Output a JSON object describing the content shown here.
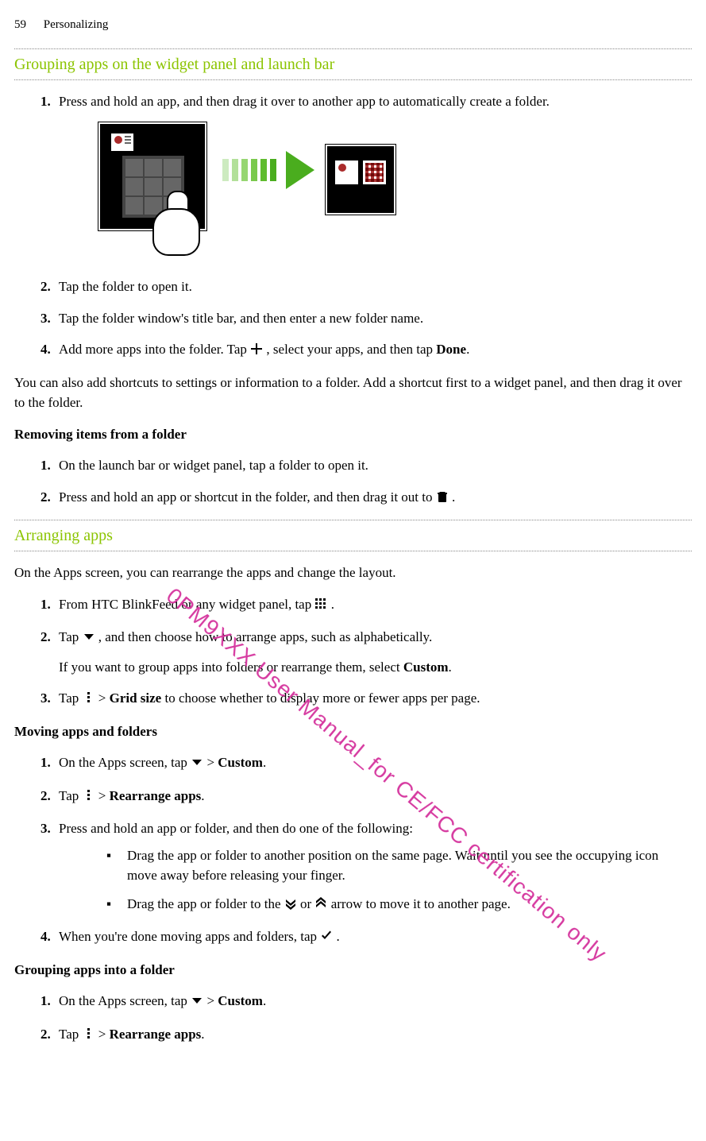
{
  "header": {
    "page_no": "59",
    "section": "Personalizing"
  },
  "watermark": "0PM9XXX User Manual_for CE/FCC certification only",
  "s1": {
    "title": "Grouping apps on the widget panel and launch bar",
    "step1": "Press and hold an app, and then drag it over to another app to automatically create a folder.",
    "step2": "Tap the folder to open it.",
    "step3": "Tap the folder window's title bar, and then enter a new folder name.",
    "step4_a": "Add more apps into the folder. Tap ",
    "step4_b": ", select your apps, and then tap ",
    "step4_done": "Done",
    "step4_c": ".",
    "after": "You can also add shortcuts to settings or information to a folder. Add a shortcut first to a widget panel, and then drag it over to the folder.",
    "sub": "Removing items from a folder",
    "r1": "On the launch bar or widget panel, tap a folder to open it.",
    "r2_a": "Press and hold an app or shortcut in the folder, and then drag it out to ",
    "r2_b": " ."
  },
  "s2": {
    "title": "Arranging apps",
    "intro": "On the Apps screen, you can rearrange the apps and change the layout.",
    "a1_a": "From HTC BlinkFeed or any widget panel, tap ",
    "a1_b": " .",
    "a2_a": "Tap ",
    "a2_b": " , and then choose how to arrange apps, such as alphabetically.",
    "a2_note_a": "If you want to group apps into folders or rearrange them, select ",
    "a2_note_custom": "Custom",
    "a2_note_b": ".",
    "a3_a": "Tap ",
    "a3_b": " > ",
    "a3_grid": "Grid size",
    "a3_c": " to choose whether to display more or fewer apps per page.",
    "moving_sub": "Moving apps and folders",
    "m1_a": "On the Apps screen, tap ",
    "m1_b": " > ",
    "m1_custom": "Custom",
    "m1_c": ".",
    "m2_a": "Tap ",
    "m2_b": " > ",
    "m2_rearr": "Rearrange apps",
    "m2_c": ".",
    "m3": "Press and hold an app or folder, and then do one of the following:",
    "m3_b1": "Drag the app or folder to another position on the same page. Wait until you see the occupying icon move away before releasing your finger.",
    "m3_b2_a": "Drag the app or folder to the ",
    "m3_b2_b": " or ",
    "m3_b2_c": " arrow to move it to another page.",
    "m4_a": "When you're done moving apps and folders, tap ",
    "m4_b": ".",
    "grouping_sub": "Grouping apps into a folder",
    "g1_a": "On the Apps screen, tap ",
    "g1_b": " > ",
    "g1_custom": "Custom",
    "g1_c": ".",
    "g2_a": "Tap ",
    "g2_b": " > ",
    "g2_rearr": "Rearrange apps",
    "g2_c": "."
  }
}
